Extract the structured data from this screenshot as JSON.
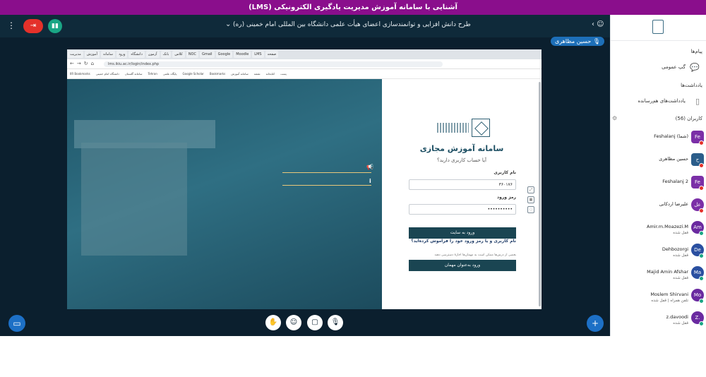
{
  "app": {
    "banner_title": "آشنایی با سامانه آموزش مدیریت یادگیری الکترونیکی (LMS)",
    "meeting_title": "طرح دانش افزایی و توانمندسازی اعضای هیأت علمی دانشگاه بین المللی امام خمینی (ره)",
    "talking_user": "حسین مظاهری"
  },
  "colors": {
    "banner": "#8a0e8c",
    "main_bg": "#0b1f2e",
    "leave_button": "#e4312a",
    "connection_button": "#1aa685",
    "accent_blue": "#1d70c6"
  },
  "icons": {
    "menu": "more-vertical-icon",
    "leave": "leave-meeting-icon",
    "connection": "connection-status-icon",
    "users_toggle": "user-icon",
    "chevron": "chevron-down-icon",
    "mic": "microphone-icon"
  },
  "shared_screen": {
    "browser_tabs": [
      "مدیریت",
      "آموزش",
      "سامانه",
      "ورود",
      "دانشگاه",
      "آزمون",
      "بانک",
      "کلاس",
      "NOC",
      "Gmail",
      "Google",
      "Moodle",
      "LMS",
      "صفحه"
    ],
    "address_url": "lms.ikiu.ac.ir/login/index.php",
    "bookmarks": [
      "IIR Bookmarks",
      "دانشگاه امام خمینی",
      "سامانه گلستان",
      "Tehran",
      "پایگاه علمی",
      "Google Scholar",
      "Bookmarks",
      "سامانه آموزش",
      "نقشه",
      "کتابخانه",
      "پست"
    ],
    "login": {
      "title": "سامانه آموزش مجازی",
      "subtitle": "آیا حساب کاربری دارید؟",
      "username_label": "نام کاربری",
      "username_value": "۳۶۰۱۷۶",
      "password_label": "رمز ورود",
      "password_value": "••••••••••",
      "login_button": "ورود به سایت",
      "forgot_link": "نام کاربری و یا رمز ورود خود را فراموش کرده‌اید؟",
      "guest_note": "بعضی از درس‌ها ممکن است به مهمان‌ها اجازهٔ دسترسی دهند",
      "guest_button": "ورود به‌عنوان مهمان"
    }
  },
  "sidebar": {
    "messages_header": "پیام‌ها",
    "public_chat": "گپ عمومی",
    "notes_header": "یادداشت‌ها",
    "shared_notes": "یادداشت‌های هم‌رسانده",
    "users_header": "کاربران (56)",
    "users": [
      {
        "initials": "Fe",
        "name": "Feshalanj (شما)",
        "status": "",
        "color": "#7b2fa7"
      },
      {
        "initials": "ح",
        "name": "حسین مظاهری",
        "status": "",
        "color": "#2b5d8a"
      },
      {
        "initials": "Fe",
        "name": "Feshalanj 2",
        "status": "",
        "color": "#7b2fa7"
      },
      {
        "initials": "عل",
        "name": "علیرضا اردکانی",
        "status": "",
        "color": "#7b2fa7"
      },
      {
        "initials": "Am",
        "name": "Amir.m.Moazezi.M",
        "status": "قفل شده",
        "color": "#6a2aa0"
      },
      {
        "initials": "De",
        "name": "Dehbozorgi",
        "status": "قفل شده",
        "color": "#2a4fa0"
      },
      {
        "initials": "Ma",
        "name": "Majid Amin Afshar",
        "status": "قفل شده",
        "color": "#2a4fa0"
      },
      {
        "initials": "Mo",
        "name": "Moslem Shirvani",
        "status": "تلفن همراه | قفل شده",
        "color": "#6a2aa0"
      },
      {
        "initials": "Z.",
        "name": "z.davoodi",
        "status": "قفل شده",
        "color": "#6a2aa0"
      }
    ]
  }
}
